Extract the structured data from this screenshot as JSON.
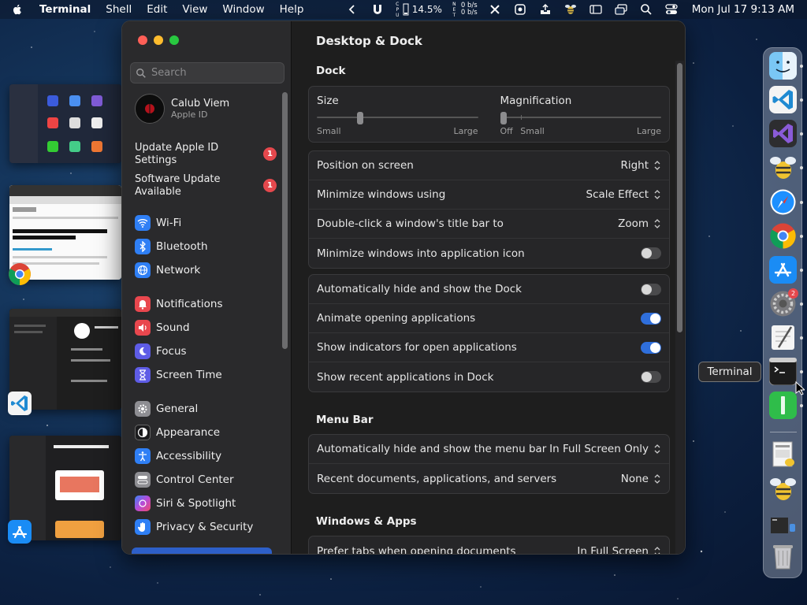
{
  "menubar": {
    "app_name": "Terminal",
    "items": [
      "Shell",
      "Edit",
      "View",
      "Window",
      "Help"
    ],
    "cpu_label": "CPU",
    "cpu_value": "14.5%",
    "net_label": "NET",
    "net_up": "0 b/s",
    "net_down": "0 b/s",
    "clock": "Mon Jul 17  9:13 AM"
  },
  "window": {
    "sidebar": {
      "search_placeholder": "Search",
      "account": {
        "name": "Calub Viem",
        "subtitle": "Apple ID"
      },
      "notices": [
        {
          "label": "Update Apple ID Settings",
          "badge": "1"
        },
        {
          "label": "Software Update Available",
          "badge": "1"
        }
      ],
      "items": [
        {
          "label": "Wi-Fi",
          "icon": "wifi-icon",
          "color": "#2f7ff5"
        },
        {
          "label": "Bluetooth",
          "icon": "bluetooth-icon",
          "color": "#2f7ff5"
        },
        {
          "label": "Network",
          "icon": "globe-icon",
          "color": "#2f7ff5"
        },
        {
          "label": "Notifications",
          "icon": "bell-icon",
          "color": "#e9474e"
        },
        {
          "label": "Sound",
          "icon": "speaker-icon",
          "color": "#e9474e"
        },
        {
          "label": "Focus",
          "icon": "moon-icon",
          "color": "#5e5ce6"
        },
        {
          "label": "Screen Time",
          "icon": "hourglass-icon",
          "color": "#5e5ce6"
        },
        {
          "label": "General",
          "icon": "gear-icon",
          "color": "#8e8e93"
        },
        {
          "label": "Appearance",
          "icon": "appearance-icon",
          "color": "#1c1c1e"
        },
        {
          "label": "Accessibility",
          "icon": "accessibility-icon",
          "color": "#2f7ff5"
        },
        {
          "label": "Control Center",
          "icon": "control-center-icon",
          "color": "#8e8e93"
        },
        {
          "label": "Siri & Spotlight",
          "icon": "siri-icon",
          "color": "#b84bd8"
        },
        {
          "label": "Privacy & Security",
          "icon": "hand-icon",
          "color": "#2f7ff5"
        }
      ]
    },
    "content": {
      "title": "Desktop & Dock",
      "dock_section": "Dock",
      "size_slider": {
        "label": "Size",
        "min_label": "Small",
        "max_label": "Large",
        "value": 0.25
      },
      "magnification_slider": {
        "label": "Magnification",
        "off_label": "Off",
        "min_label": "Small",
        "max_label": "Large",
        "value": 0
      },
      "dock_settings": [
        {
          "label": "Position on screen",
          "value": "Right"
        },
        {
          "label": "Minimize windows using",
          "value": "Scale Effect"
        },
        {
          "label": "Double-click a window's title bar to",
          "value": "Zoom"
        },
        {
          "label": "Minimize windows into application icon",
          "toggle": false
        }
      ],
      "dock_toggles": [
        {
          "label": "Automatically hide and show the Dock",
          "toggle": false
        },
        {
          "label": "Animate opening applications",
          "toggle": true
        },
        {
          "label": "Show indicators for open applications",
          "toggle": true
        },
        {
          "label": "Show recent applications in Dock",
          "toggle": false
        }
      ],
      "menubar_section": "Menu Bar",
      "menubar_settings": [
        {
          "label": "Automatically hide and show the menu bar",
          "value": "In Full Screen Only"
        },
        {
          "label": "Recent documents, applications, and servers",
          "value": "None"
        }
      ],
      "windows_section": "Windows & Apps",
      "windows_settings": [
        {
          "label": "Prefer tabs when opening documents",
          "value": "In Full Screen"
        }
      ]
    }
  },
  "dock": {
    "tooltip": "Terminal",
    "settings_badge": "2"
  },
  "colors": {
    "accent": "#2f6fdc",
    "badge": "#e5484d"
  }
}
